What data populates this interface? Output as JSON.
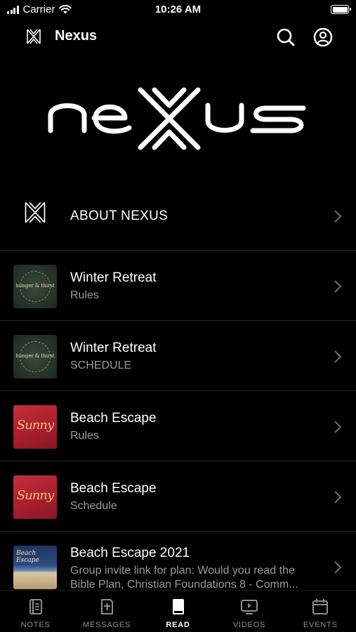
{
  "status_bar": {
    "carrier": "Carrier",
    "time": "10:26 AM"
  },
  "nav": {
    "title": "Nexus"
  },
  "banner": {
    "logo_text": "nexus"
  },
  "items": [
    {
      "title": "ABOUT NEXUS",
      "subtitle": "",
      "thumb": "nexus-logo"
    },
    {
      "title": "Winter Retreat",
      "subtitle": "Rules",
      "thumb": "hunger & thirst"
    },
    {
      "title": "Winter Retreat",
      "subtitle": "SCHEDULE",
      "thumb": "hunger & thirst"
    },
    {
      "title": "Beach Escape",
      "subtitle": "Rules",
      "thumb": "Sunny"
    },
    {
      "title": "Beach Escape",
      "subtitle": "Schedule",
      "thumb": "Sunny"
    },
    {
      "title": "Beach Escape 2021",
      "subtitle_line1": "Group invite link for plan: Would you read the",
      "subtitle_line2": "Bible Plan, Christian Foundations 8 - Comm...",
      "thumb": "Beach Escape"
    }
  ],
  "tabs": [
    {
      "label": "NOTES",
      "icon": "notes-icon",
      "active": false
    },
    {
      "label": "MESSAGES",
      "icon": "messages-icon",
      "active": false
    },
    {
      "label": "READ",
      "icon": "read-icon",
      "active": true
    },
    {
      "label": "VIDEOS",
      "icon": "videos-icon",
      "active": false
    },
    {
      "label": "EVENTS",
      "icon": "events-icon",
      "active": false
    }
  ],
  "colors": {
    "background": "#000000",
    "text": "#ffffff",
    "subtext": "#9a9a9a",
    "tab_inactive": "#8e8e8e"
  }
}
